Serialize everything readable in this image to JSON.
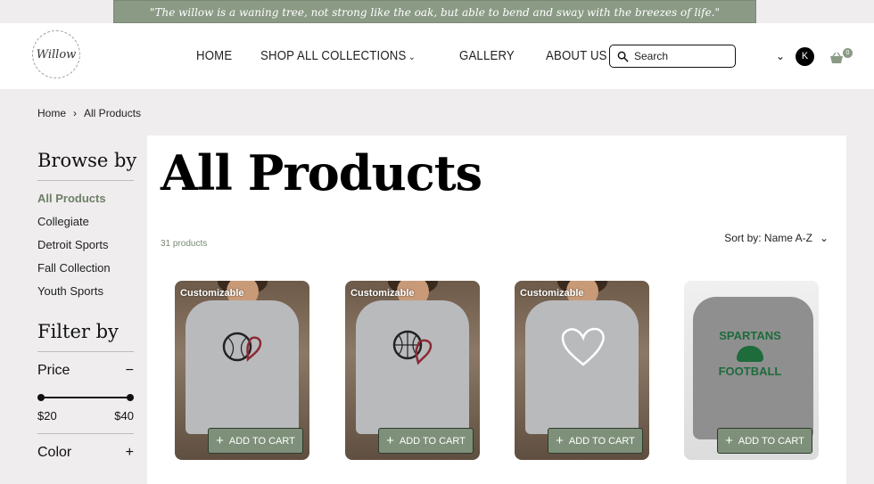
{
  "announcement": "\"The willow is a waning tree, not strong like the oak, but able to bend and sway with the breezes of life.\"",
  "logo": "Willow",
  "nav": [
    {
      "label": "HOME"
    },
    {
      "label": "SHOP ALL COLLECTIONS"
    },
    {
      "label": "GALLERY"
    },
    {
      "label": "ABOUT US"
    }
  ],
  "search": {
    "placeholder": "Search"
  },
  "account": {
    "initial": "K"
  },
  "cart": {
    "count": "0"
  },
  "breadcrumb": {
    "home": "Home",
    "current": "All Products"
  },
  "sidebar": {
    "browse_title": "Browse by",
    "categories": [
      "All Products",
      "Collegiate",
      "Detroit Sports",
      "Fall Collection",
      "Youth Sports"
    ],
    "filter_title": "Filter by",
    "price_label": "Price",
    "price_min": "$20",
    "price_max": "$40",
    "color_label": "Color"
  },
  "main": {
    "title": "All Products",
    "count": "31 products",
    "sort": "Sort by: Name A-Z"
  },
  "products": [
    {
      "tag": "Customizable",
      "button": "ADD TO CART",
      "art": "baseball-heart"
    },
    {
      "tag": "Customizable",
      "button": "ADD TO CART",
      "art": "basketball-heart"
    },
    {
      "tag": "Customizable",
      "button": "ADD TO CART",
      "art": "cheer-heart"
    },
    {
      "tag": "",
      "button": "ADD TO CART",
      "art": "spartans-football",
      "shirt_text_1": "SPARTANS",
      "shirt_text_2": "FOOTBALL"
    }
  ],
  "colors": {
    "accent": "#8a9a84",
    "button": "#7e9079",
    "active": "#6d7f67"
  }
}
